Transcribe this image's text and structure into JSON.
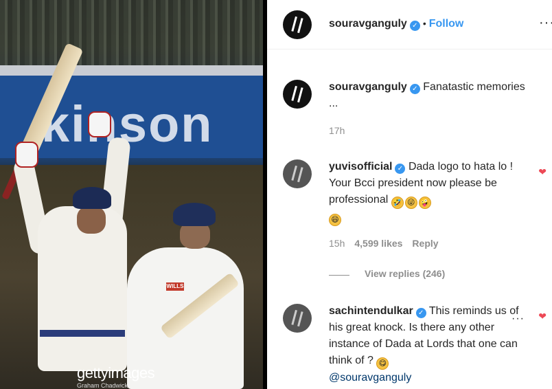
{
  "photo": {
    "banner_text": "kinson",
    "watermark": "gettyimages",
    "watermark_sub": "Graham Chadwick",
    "jersey_logo": "WILLS"
  },
  "post": {
    "author": "souravganguly",
    "follow_label": "Follow",
    "separator": "•",
    "more_icon": "more-horizontal-icon",
    "caption": "Fanatastic memories ...",
    "caption_time": "17h"
  },
  "comments": [
    {
      "user": "yuvisofficial",
      "text": "Dada logo to hata lo ! Your Bcci president now please be professional",
      "emojis": [
        "🤣",
        "😜",
        "🤪",
        "😄"
      ],
      "time": "15h",
      "likes": "4,599 likes",
      "reply_label": "Reply",
      "liked": true
    },
    {
      "user": "sachintendulkar",
      "text": "This reminds us of his great knock. Is there any other instance of Dada at Lords that one can think of ?",
      "emoji": "😋",
      "mention": "@souravganguly",
      "liked": true
    }
  ],
  "view_replies_label": "View replies (246)",
  "colors": {
    "link": "#3897f0",
    "heart": "#ed4956",
    "muted": "#8e8e8e"
  }
}
